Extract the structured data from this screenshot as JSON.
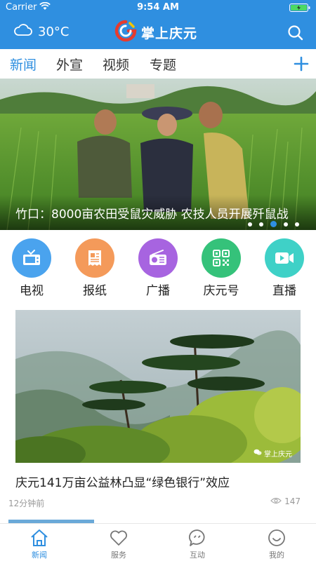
{
  "status_bar": {
    "carrier": "Carrier",
    "time": "9:54 AM"
  },
  "app_bar": {
    "temperature": "30°C",
    "logo_text": "掌上庆元",
    "weather_icon": "cloud-icon",
    "search_icon": "search-icon"
  },
  "tabs": [
    {
      "label": "新闻",
      "active": true
    },
    {
      "label": "外宣",
      "active": false
    },
    {
      "label": "视频",
      "active": false
    },
    {
      "label": "专题",
      "active": false
    }
  ],
  "banner": {
    "title": "竹口：8000亩农田受鼠灾威胁 农技人员开展歼鼠战",
    "slide_count": 5,
    "active_slide": 3
  },
  "quick_entries": [
    {
      "label": "电视",
      "icon": "tv-icon",
      "color": "#4aa3ee"
    },
    {
      "label": "报纸",
      "icon": "newspaper-icon",
      "color": "#f49a5a"
    },
    {
      "label": "广播",
      "icon": "radio-icon",
      "color": "#a764e0"
    },
    {
      "label": "庆元号",
      "icon": "qr-code-icon",
      "color": "#35c27a"
    },
    {
      "label": "直播",
      "icon": "video-camera-icon",
      "color": "#3fd1c7"
    }
  ],
  "article": {
    "title": "庆元141万亩公益林凸显“绿色银行”效应",
    "time": "12分钟前",
    "views": "147",
    "watermark": "掌上庆元"
  },
  "bottom_nav": [
    {
      "label": "新闻",
      "icon": "home-icon",
      "active": true
    },
    {
      "label": "服务",
      "icon": "heart-icon",
      "active": false
    },
    {
      "label": "互动",
      "icon": "chat-icon",
      "active": false
    },
    {
      "label": "我的",
      "icon": "smile-face-icon",
      "active": false
    }
  ],
  "colors": {
    "brand_blue": "#2f8fe0",
    "text_dark": "#222222",
    "text_muted": "#999999"
  }
}
